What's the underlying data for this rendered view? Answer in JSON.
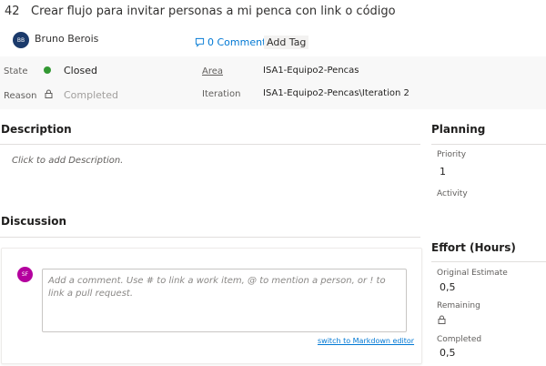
{
  "work_item": {
    "id": "42",
    "title": "Crear flujo para invitar personas a mi penca con link o código"
  },
  "header": {
    "owner_initials": "BB",
    "owner_name": "Bruno Berois",
    "comments_label": "0 Comments",
    "add_tag_label": "Add Tag"
  },
  "fields": {
    "state_label": "State",
    "state_value": "Closed",
    "state_color": "#339933",
    "reason_label": "Reason",
    "reason_value": "Completed",
    "area_label": "Area",
    "area_value": "ISA1-Equipo2-Pencas",
    "iteration_label": "Iteration",
    "iteration_value": "ISA1-Equipo2-Pencas\\Iteration 2"
  },
  "description": {
    "title": "Description",
    "placeholder": "Click to add Description."
  },
  "discussion": {
    "title": "Discussion",
    "commenter_initials": "SF",
    "comment_placeholder": "Add a comment. Use # to link a work item, @ to mention a person, or ! to link a pull request.",
    "markdown_link": "switch to Markdown editor"
  },
  "planning": {
    "title": "Planning",
    "priority_label": "Priority",
    "priority_value": "1",
    "activity_label": "Activity"
  },
  "effort": {
    "title": "Effort (Hours)",
    "original_label": "Original Estimate",
    "original_value": "0,5",
    "remaining_label": "Remaining",
    "completed_label": "Completed",
    "completed_value": "0,5"
  }
}
